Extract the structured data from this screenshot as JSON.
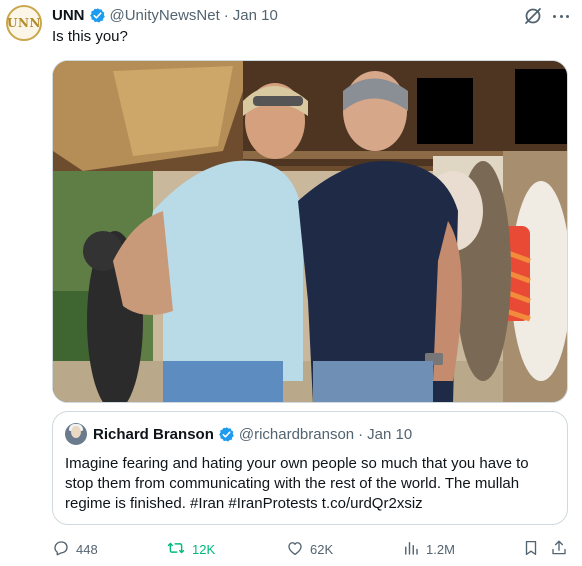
{
  "author": {
    "avatar_text": "UNN",
    "name": "UNN",
    "handle": "@UnityNewsNet",
    "separator": "·",
    "date": "Jan 10"
  },
  "tweet": {
    "text": "Is this you?"
  },
  "quoted": {
    "name": "Richard Branson",
    "handle": "@richardbranson",
    "separator": "·",
    "date": "Jan 10",
    "text": "Imagine fearing and hating your own people so much that you have to stop them from communicating with the rest of the world. The mullah regime is finished. #Iran #IranProtests t.co/urdQr2xsiz"
  },
  "actions": {
    "replies": "448",
    "reposts": "12K",
    "likes": "62K",
    "views": "1.2M"
  },
  "colors": {
    "verified": "#1d9bf0",
    "repost_active": "#00ba7c",
    "muted_text": "#536471",
    "border": "#cfd9de"
  },
  "icons": [
    "grok-icon",
    "more-icon",
    "verified-icon",
    "reply-icon",
    "repost-icon",
    "like-icon",
    "views-icon",
    "bookmark-icon",
    "share-icon"
  ]
}
